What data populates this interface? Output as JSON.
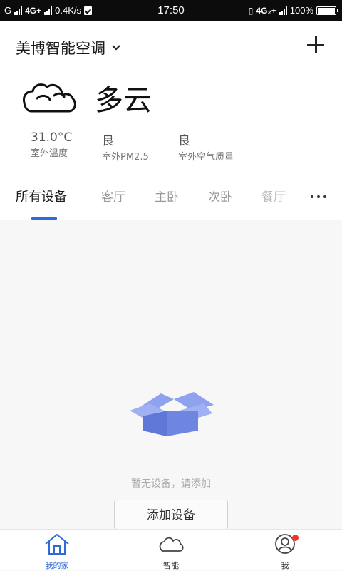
{
  "status_bar": {
    "carrier1": "G",
    "network": "4G+",
    "speed": "0.4K/s",
    "time": "17:50",
    "network2": "4G₂+",
    "battery": "100%"
  },
  "header": {
    "home_name": "美博智能空调"
  },
  "weather": {
    "condition": "多云",
    "stats": [
      {
        "value": "31.0°C",
        "label": "室外温度"
      },
      {
        "value": "良",
        "label": "室外PM2.5"
      },
      {
        "value": "良",
        "label": "室外空气质量"
      }
    ]
  },
  "tabs": [
    {
      "label": "所有设备",
      "active": true
    },
    {
      "label": "客厅"
    },
    {
      "label": "主卧"
    },
    {
      "label": "次卧"
    },
    {
      "label": "餐厅"
    }
  ],
  "empty": {
    "message": "暂无设备，请添加",
    "button_label": "添加设备"
  },
  "bottom_nav": [
    {
      "label": "我的家",
      "icon": "home-icon",
      "active": true
    },
    {
      "label": "智能",
      "icon": "cloud-icon"
    },
    {
      "label": "我",
      "icon": "user-icon",
      "badge": true
    }
  ],
  "colors": {
    "accent": "#2f6bd8",
    "badge": "#f2352b",
    "box": "#6e86e0"
  }
}
